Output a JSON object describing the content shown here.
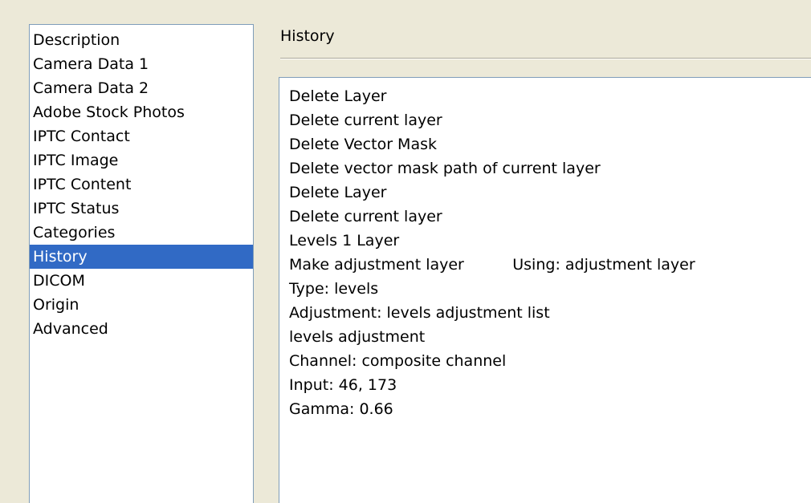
{
  "sidebar": {
    "items": [
      {
        "label": "Description",
        "selected": false
      },
      {
        "label": "Camera Data 1",
        "selected": false
      },
      {
        "label": "Camera Data 2",
        "selected": false
      },
      {
        "label": "Adobe Stock Photos",
        "selected": false
      },
      {
        "label": "IPTC Contact",
        "selected": false
      },
      {
        "label": "IPTC Image",
        "selected": false
      },
      {
        "label": "IPTC Content",
        "selected": false
      },
      {
        "label": "IPTC Status",
        "selected": false
      },
      {
        "label": "Categories",
        "selected": false
      },
      {
        "label": "History",
        "selected": true
      },
      {
        "label": "DICOM",
        "selected": false
      },
      {
        "label": "Origin",
        "selected": false
      },
      {
        "label": "Advanced",
        "selected": false
      }
    ]
  },
  "panel": {
    "title": "History",
    "lines": [
      "Delete Layer",
      "Delete current layer",
      "Delete Vector Mask",
      "Delete vector mask path of current layer",
      "Delete Layer",
      "Delete current layer",
      "Levels 1 Layer",
      "Make adjustment layer          Using: adjustment layer",
      "Type: levels",
      "Adjustment: levels adjustment list",
      "levels adjustment",
      "Channel: composite channel",
      "Input: 46, 173",
      "Gamma: 0.66"
    ]
  },
  "colors": {
    "background": "#ECE9D8",
    "selection": "#316AC5",
    "border": "#7F9DB9"
  }
}
